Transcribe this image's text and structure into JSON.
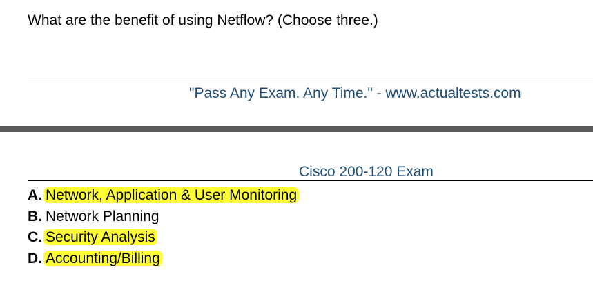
{
  "question": {
    "text": "What are the benefit of using Netflow? (Choose three.)"
  },
  "footer": {
    "text": "\"Pass Any Exam. Any Time.\" - www.actualtests.com"
  },
  "header": {
    "text": "Cisco 200-120 Exam"
  },
  "colors": {
    "link_blue": "#1f4e79",
    "highlight": "#ffff33",
    "page_break": "#5a5a5a"
  },
  "answers": [
    {
      "letter": "A.",
      "text": "Network, Application & User Monitoring",
      "highlighted": true
    },
    {
      "letter": "B.",
      "text": "Network Planning",
      "highlighted": false
    },
    {
      "letter": "C.",
      "text": "Security Analysis",
      "highlighted": true
    },
    {
      "letter": "D.",
      "text": "Accounting/Billing",
      "highlighted": true
    }
  ]
}
